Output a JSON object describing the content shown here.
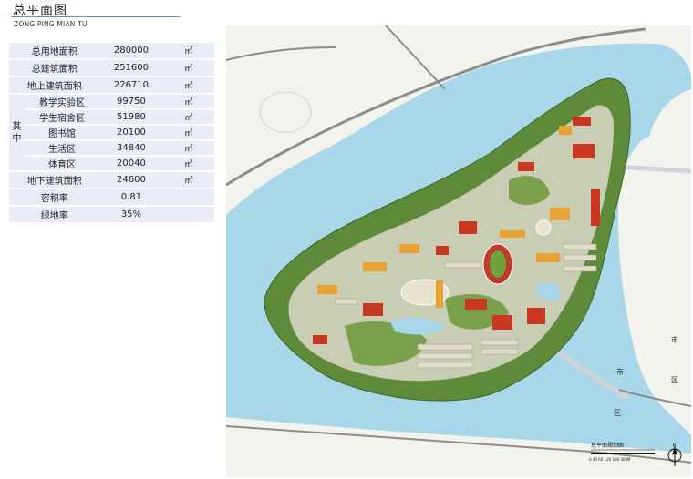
{
  "header": {
    "title": "总平面图",
    "subtitle": "ZONG PING MIAN TU"
  },
  "stats": {
    "rows": [
      {
        "label": "总用地面积",
        "value": "280000",
        "unit": "㎡"
      },
      {
        "label": "总建筑面积",
        "value": "251600",
        "unit": "㎡"
      },
      {
        "label": "地上建筑面积",
        "value": "226710",
        "unit": "㎡"
      }
    ],
    "group_label": "其中",
    "group_rows": [
      {
        "label": "教学实验区",
        "value": "99750",
        "unit": "㎡"
      },
      {
        "label": "学生宿舍区",
        "value": "51980",
        "unit": "㎡"
      },
      {
        "label": "图书馆",
        "value": "20100",
        "unit": "㎡"
      },
      {
        "label": "生活区",
        "value": "34840",
        "unit": "㎡"
      },
      {
        "label": "体育区",
        "value": "20040",
        "unit": "㎡"
      }
    ],
    "tail_rows": [
      {
        "label": "地下建筑面积",
        "value": "24600",
        "unit": "㎡"
      },
      {
        "label": "容积率",
        "value": "0.81",
        "unit": ""
      },
      {
        "label": "绿地率",
        "value": "35%",
        "unit": ""
      }
    ]
  },
  "map": {
    "labels": {
      "city_1a": "市",
      "city_1b": "区",
      "city_2a": "市",
      "city_2b": "区"
    },
    "plan_title": "总平面规划图",
    "scale_text": "0 20 60  120  200       300M",
    "north": "N",
    "colors": {
      "water": "#a9d7ea",
      "land": "#f4f4ef",
      "green": "#5e8a3a",
      "red_building": "#c8371f",
      "orange_building": "#e6a232",
      "light_building": "#d9d8c8"
    }
  }
}
